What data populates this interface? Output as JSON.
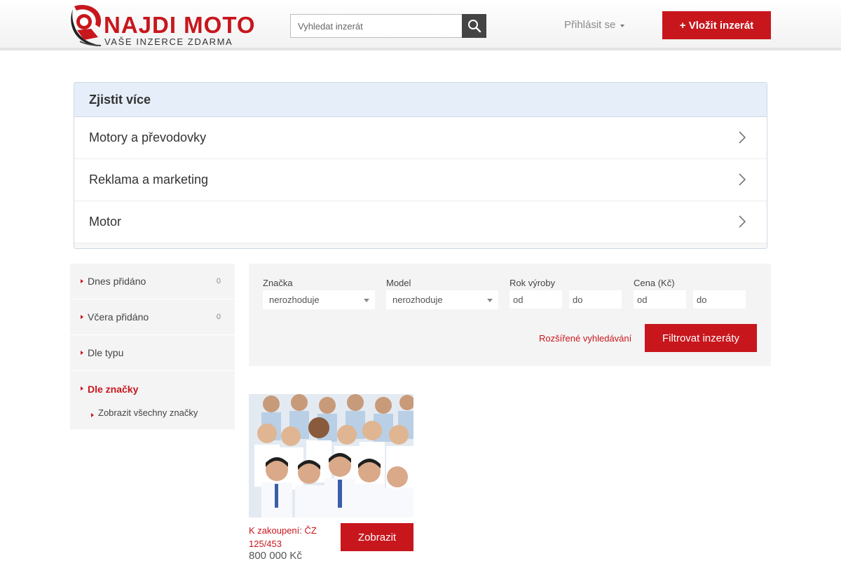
{
  "header": {
    "logo_title": "NAJDI MOTO",
    "logo_subtitle": "VAŠE INZERCE ZDARMA",
    "search_placeholder": "Vyhledat inzerát",
    "search_icon": "magnifier-icon",
    "login_label": "Přihlásit se",
    "add_button_label": "+ Vložit inzerát"
  },
  "info_panel": {
    "title": "Zjistit více",
    "items": [
      {
        "label": "Motory a převodovky"
      },
      {
        "label": "Reklama a marketing"
      },
      {
        "label": "Motor"
      }
    ]
  },
  "sidebar": {
    "items": [
      {
        "label": "Dnes přidáno",
        "count": "0"
      },
      {
        "label": "Včera přidáno",
        "count": "0"
      },
      {
        "label": "Dle typu"
      }
    ],
    "active": {
      "label": "Dle značky",
      "sub_label": "Zobrazit všechny značky"
    }
  },
  "filter": {
    "brand_label": "Značka",
    "brand_value": "nerozhoduje",
    "model_label": "Model",
    "model_value": "nerozhoduje",
    "year_label": "Rok výroby",
    "year_from_placeholder": "od",
    "year_to_placeholder": "do",
    "price_label": "Cena (Kč)",
    "price_from_placeholder": "od",
    "price_to_placeholder": "do",
    "advanced_link": "Rozšířené vyhledávání",
    "submit_label": "Filtrovat inzeráty"
  },
  "listing": {
    "title": "K zakoupení: ČZ 125/453",
    "price": "800 000 Kč",
    "show_button": "Zobrazit"
  },
  "colors": {
    "accent": "#c8161d",
    "panel_header": "#e6eef9",
    "filter_bg": "#f4f4f4"
  }
}
